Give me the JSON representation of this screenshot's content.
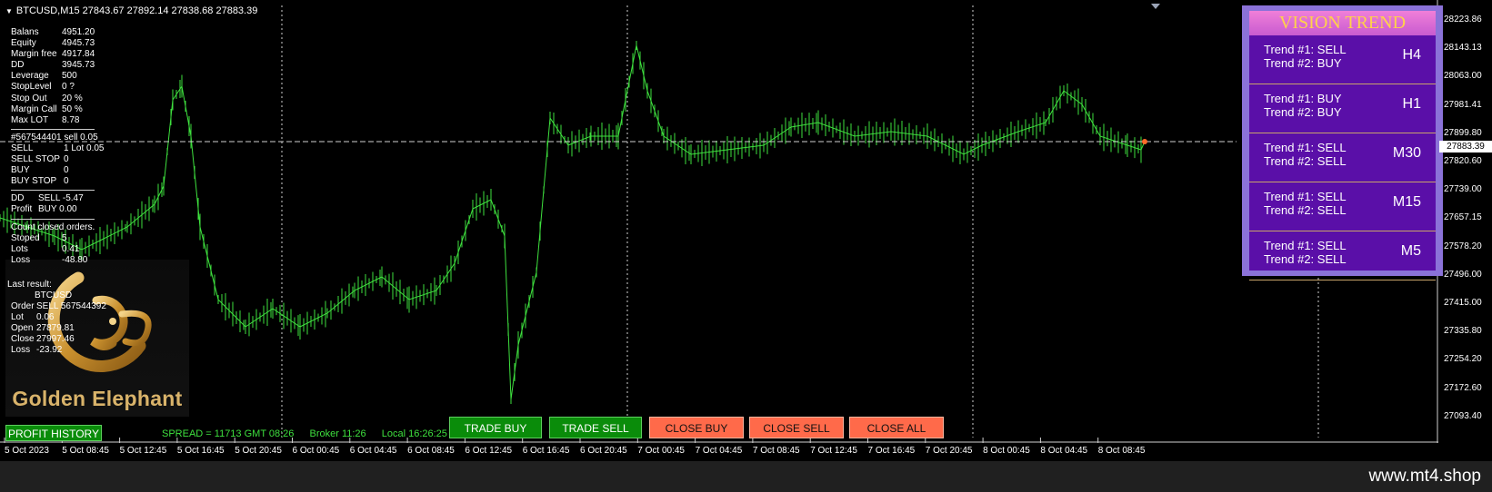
{
  "header": {
    "symbol_line": "BTCUSD,M15  27843.67 27892.14 27838.68 27883.39"
  },
  "account": [
    {
      "label": "Balans",
      "value": "4951.20"
    },
    {
      "label": "Equity",
      "value": "4945.73"
    },
    {
      "label": "Margin free",
      "value": "4917.84"
    },
    {
      "label": "DD",
      "value": "3945.73"
    },
    {
      "label": "Leverage",
      "value": "500"
    },
    {
      "label": "StopLevel",
      "value": "0 ?"
    },
    {
      "label": "Stop Out",
      "value": "20 %"
    },
    {
      "label": "Margin Call",
      "value": "50 %"
    },
    {
      "label": "Max LOT",
      "value": "8.78"
    }
  ],
  "order_line": "#567544401 sell 0.05",
  "orders": [
    {
      "label": "SELL",
      "value": "1   Lot   0.05"
    },
    {
      "label": "SELL STOP",
      "value": "0"
    },
    {
      "label": "BUY",
      "value": "0"
    },
    {
      "label": "BUY STOP",
      "value": "0"
    }
  ],
  "dd_profit": [
    {
      "label": "DD",
      "value": "SELL  -5.47"
    },
    {
      "label": "Profit",
      "value": "BUY  0.00"
    }
  ],
  "closed": {
    "title": "Count closed orders.",
    "rows": [
      {
        "label": "Stoped",
        "value": "5"
      },
      {
        "label": "Lots",
        "value": "0.41"
      },
      {
        "label": "Loss",
        "value": "-48.80"
      }
    ]
  },
  "last_result": {
    "title": "Last result:",
    "symbol": "BTCUSD",
    "rows": [
      {
        "label": "Order",
        "value": "SELL  567544392"
      },
      {
        "label": "Lot",
        "value": "0.06"
      },
      {
        "label": "Open",
        "value": "27879.81"
      },
      {
        "label": "Close",
        "value": "27997.46"
      },
      {
        "label": "Loss",
        "value": "-23.92"
      }
    ]
  },
  "logo": {
    "text": "Golden Elephant"
  },
  "buttons": {
    "profit_history": "PROFIT HISTORY",
    "trade_buy": "TRADE BUY",
    "trade_sell": "TRADE SELL",
    "close_buy": "CLOSE BUY",
    "close_sell": "CLOSE SELL",
    "close_all": "CLOSE ALL"
  },
  "status": {
    "spread": "SPREAD = 11713 GMT 08:26",
    "broker": "Broker 11:26",
    "local": "Local 16:26:25"
  },
  "vision_trend": {
    "title": "VISION TREND",
    "rows": [
      {
        "t1": "Trend #1: SELL",
        "t2": "Trend #2: BUY",
        "tf": "H4"
      },
      {
        "t1": "Trend #1: BUY",
        "t2": "Trend #2: BUY",
        "tf": "H1"
      },
      {
        "t1": "Trend #1: SELL",
        "t2": "Trend #2: SELL",
        "tf": "M30"
      },
      {
        "t1": "Trend #1: SELL",
        "t2": "Trend #2: SELL",
        "tf": "M15"
      },
      {
        "t1": "Trend #1: SELL",
        "t2": "Trend #2: SELL",
        "tf": "M5"
      }
    ]
  },
  "price_axis": [
    "28223.86",
    "28143.13",
    "28063.00",
    "27981.41",
    "27899.80",
    "27820.60",
    "27739.00",
    "27657.15",
    "27578.20",
    "27496.00",
    "27415.00",
    "27335.80",
    "27254.20",
    "27172.60",
    "27093.40"
  ],
  "current_price": "27883.39",
  "time_axis": [
    "5 Oct 2023",
    "5 Oct 08:45",
    "5 Oct 12:45",
    "5 Oct 16:45",
    "5 Oct 20:45",
    "6 Oct 00:45",
    "6 Oct 04:45",
    "6 Oct 08:45",
    "6 Oct 12:45",
    "6 Oct 16:45",
    "6 Oct 20:45",
    "7 Oct 00:45",
    "7 Oct 04:45",
    "7 Oct 08:45",
    "7 Oct 12:45",
    "7 Oct 16:45",
    "7 Oct 20:45",
    "8 Oct 00:45",
    "8 Oct 04:45",
    "8 Oct 08:45"
  ],
  "footer": {
    "site": "www.mt4.shop"
  },
  "colors": {
    "candle": "#3ee03e",
    "grid": "#cfcfcf",
    "panel": "#8b72d8",
    "panel_body": "#5a0fa8"
  }
}
